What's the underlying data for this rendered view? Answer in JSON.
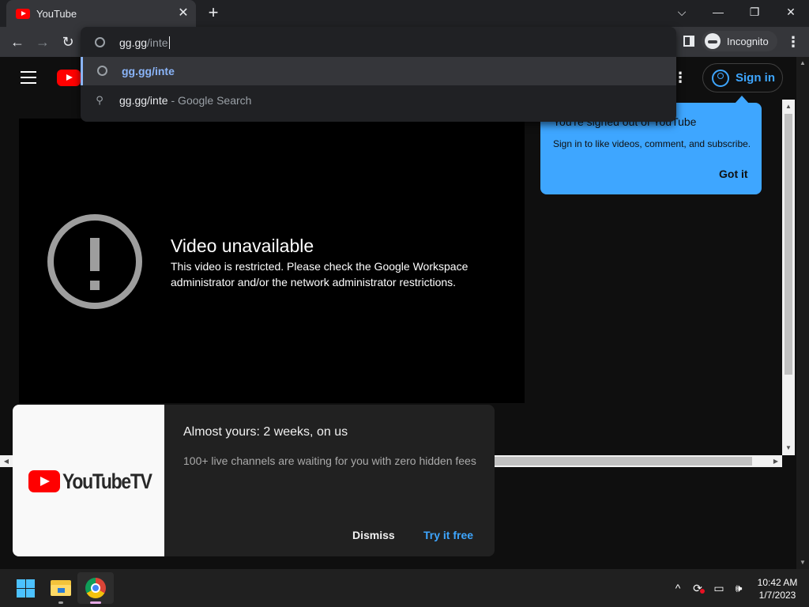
{
  "browser": {
    "tab_title": "YouTube",
    "tab_close": "✕",
    "new_tab": "+",
    "window_controls": {
      "tab_search": "⌵",
      "minimize": "—",
      "restore": "❐",
      "close": "✕"
    },
    "nav": {
      "back": "←",
      "forward": "→",
      "reload": "↻"
    },
    "incognito_label": "Incognito",
    "menu": "⋮"
  },
  "omnibox": {
    "typed": "gg.gg",
    "typed_rest": "/inte",
    "suggestions": [
      {
        "text": "gg.gg/inte",
        "icon": "globe-icon"
      },
      {
        "text": "gg.gg/inte",
        "suffix": "- Google Search",
        "icon": "search-icon"
      }
    ]
  },
  "youtube": {
    "sign_in": "Sign in",
    "more": "⋮",
    "tooltip": {
      "title": "You're signed out of YouTube",
      "body": "Sign in to like videos, comment, and subscribe.",
      "button": "Got it"
    },
    "player": {
      "title": "Video unavailable",
      "message": "This video is restricted. Please check the Google Workspace administrator and/or the network administrator restrictions."
    },
    "promo": {
      "logo_text": "YouTubeTV",
      "title": "Almost yours: 2 weeks, on us",
      "body": "100+ live channels are waiting for you with zero hidden fees",
      "dismiss": "Dismiss",
      "try": "Try it free"
    }
  },
  "scrollbars": {
    "up": "▲",
    "down": "▼",
    "left": "◀",
    "right": "▶"
  },
  "taskbar": {
    "tray": {
      "chevron": "^",
      "sync": "⟳",
      "display": "▭",
      "volume": "🕪"
    },
    "time": "10:42 AM",
    "date": "1/7/2023"
  },
  "colors": {
    "accent": "#3ea6ff",
    "youtube_red": "#ff0000",
    "omnibox_link": "#8ab4f8"
  }
}
